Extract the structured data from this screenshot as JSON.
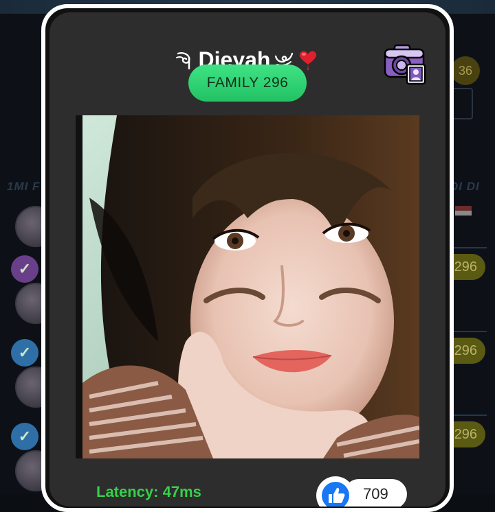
{
  "background": {
    "header_left": "1MI F",
    "header_right": "DI DI",
    "count_badge": "36",
    "pills": [
      "296",
      "296",
      "296"
    ]
  },
  "profile": {
    "username": "Dieyah",
    "family_badge": "FAMILY 296",
    "latency": "Latency: 47ms",
    "likes": "709"
  },
  "icons": {
    "left_deco": "wing-swirl-icon",
    "right_deco": "wing-swirl-icon",
    "heart": "heart-icon",
    "camera": "camera-icon",
    "like": "thumbs-up-icon"
  },
  "colors": {
    "family_badge": "#2ed573",
    "latency": "#35d14a",
    "like": "#1877f2",
    "heart": "#e0202e",
    "camera": "#8a5fc2"
  }
}
